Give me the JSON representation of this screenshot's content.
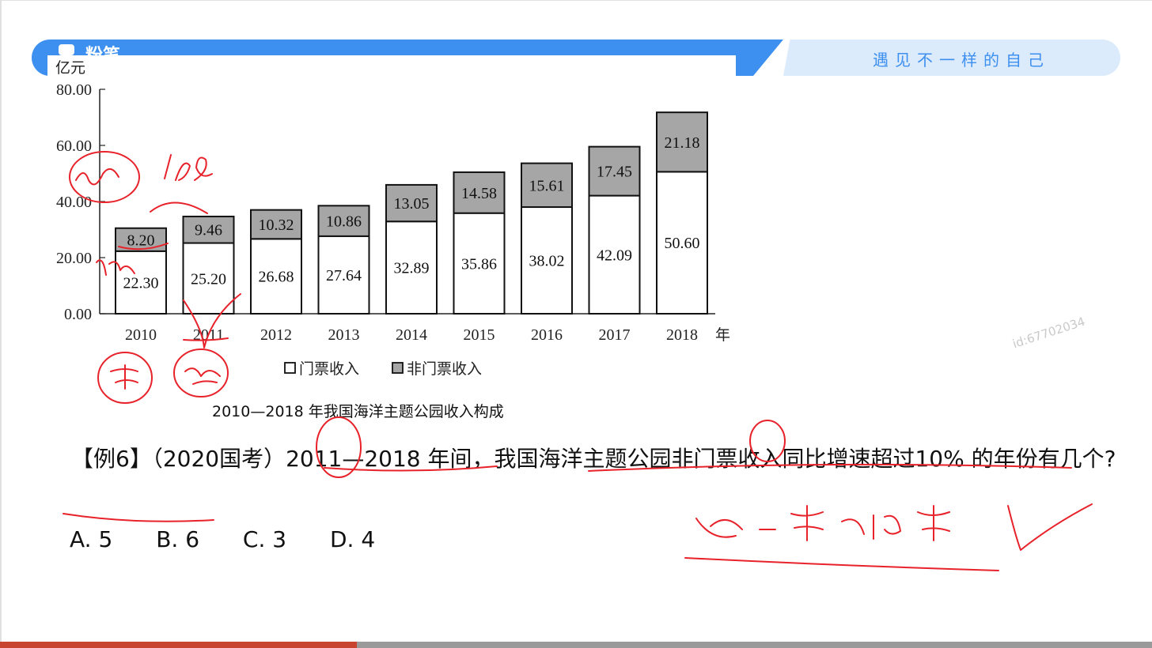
{
  "header": {
    "brand": "粉笔",
    "slogan": "遇见不一样的自己"
  },
  "watermark": "id:67702034",
  "chart_data": {
    "type": "bar",
    "stacked": true,
    "title": "2010—2018 年我国海洋主题公园收入构成",
    "ylabel": "亿元",
    "xlabel_suffix": "年",
    "ylim": [
      0,
      80
    ],
    "yticks": [
      "0.00",
      "20.00",
      "40.00",
      "60.00",
      "80.00"
    ],
    "categories": [
      "2010",
      "2011",
      "2012",
      "2013",
      "2014",
      "2015",
      "2016",
      "2017",
      "2018"
    ],
    "series": [
      {
        "name": "门票收入",
        "color": "#ffffff",
        "values": [
          22.3,
          25.2,
          26.68,
          27.64,
          32.89,
          35.86,
          38.02,
          42.09,
          50.6
        ],
        "labels": [
          "22.30",
          "25.20",
          "26.68",
          "27.64",
          "32.89",
          "35.86",
          "38.02",
          "42.09",
          "50.60"
        ]
      },
      {
        "name": "非门票收入",
        "color": "#a6a6a6",
        "values": [
          8.2,
          9.46,
          10.32,
          10.86,
          13.05,
          14.58,
          15.61,
          17.45,
          21.18
        ],
        "labels": [
          "8.20",
          "9.46",
          "10.32",
          "10.86",
          "13.05",
          "14.58",
          "15.61",
          "17.45",
          "21.18"
        ]
      }
    ],
    "legend": "bottom",
    "grid": false
  },
  "question": {
    "text": "【例6】（2020国考）2011—2018 年间，我国海洋主题公园非门票收入同比增速超过10% 的年份有几个?",
    "options": [
      "A. 5",
      "B. 6",
      "C. 3",
      "D. 4"
    ]
  },
  "annotations": {
    "color": "#e8222a"
  },
  "progress": {
    "fraction": 0.31
  }
}
